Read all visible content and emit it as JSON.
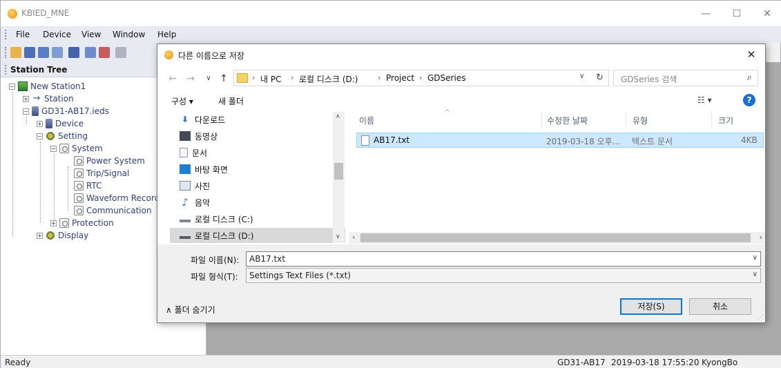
{
  "app": {
    "title": "KBIED_MNE",
    "window_buttons": {
      "minimize": "—",
      "maximize": "☐",
      "close": "✕"
    }
  },
  "menubar": [
    "File",
    "Device",
    "View",
    "Window",
    "Help"
  ],
  "station_tree": {
    "header": "Station Tree",
    "nodes": {
      "root": "New Station1",
      "station": "Station",
      "ieds": "GD31-AB17.ieds",
      "device": "Device",
      "setting": "Setting",
      "system": "System",
      "power_system": "Power System",
      "trip_signal": "Trip/Signal",
      "rtc": "RTC",
      "waveform_record": "Waveform Record",
      "communication": "Communication",
      "protection": "Protection",
      "display": "Display"
    }
  },
  "status_bar": {
    "ready": "Ready",
    "device": "GD31-AB17",
    "datetime": "2019-03-18 17:55:20",
    "user": "KyongBo"
  },
  "save_dialog": {
    "title": "다른 이름으로 저장",
    "close": "✕",
    "breadcrumb": [
      "내 PC",
      "로컬 디스크 (D:)",
      "Project",
      "GDSeries"
    ],
    "search_placeholder": "GDSeries 검색",
    "commands": {
      "organize": "구성 ▾",
      "new_folder": "새 폴더"
    },
    "nav_items": [
      {
        "label": "다운로드",
        "icon": "download-icon",
        "color": "#2b79d4"
      },
      {
        "label": "동영상",
        "icon": "video-icon",
        "color": "#444a55"
      },
      {
        "label": "문서",
        "icon": "document-icon",
        "color": "#8a9bb0"
      },
      {
        "label": "바탕 화면",
        "icon": "desktop-icon",
        "color": "#1f7fd3"
      },
      {
        "label": "사진",
        "icon": "pictures-icon",
        "color": "#6f8aa8"
      },
      {
        "label": "음악",
        "icon": "music-icon",
        "color": "#2b79d4"
      },
      {
        "label": "로컬 디스크 (C:)",
        "icon": "drive-c-icon",
        "color": "#7c8694"
      },
      {
        "label": "로컬 디스크 (D:)",
        "icon": "drive-d-icon",
        "color": "#555c66",
        "selected": true
      }
    ],
    "columns": [
      "이름",
      "수정한 날짜",
      "유형",
      "크기"
    ],
    "files": [
      {
        "name": "AB17.txt",
        "modified": "2019-03-18 오후...",
        "type": "텍스트 문서",
        "size": "4KB",
        "selected": true
      }
    ],
    "filename_label": "파일 이름(N):",
    "filename_value": "AB17.txt",
    "filetype_label": "파일 형식(T):",
    "filetype_value": "Settings Text Files (*.txt)",
    "hide_folders": "∧  폴더 숨기기",
    "save_button": "저장(S)",
    "cancel_button": "취소"
  },
  "colors": {
    "accent": "#0078d7",
    "selection": "#cce8ff",
    "workspace": "#aaaaaa"
  }
}
